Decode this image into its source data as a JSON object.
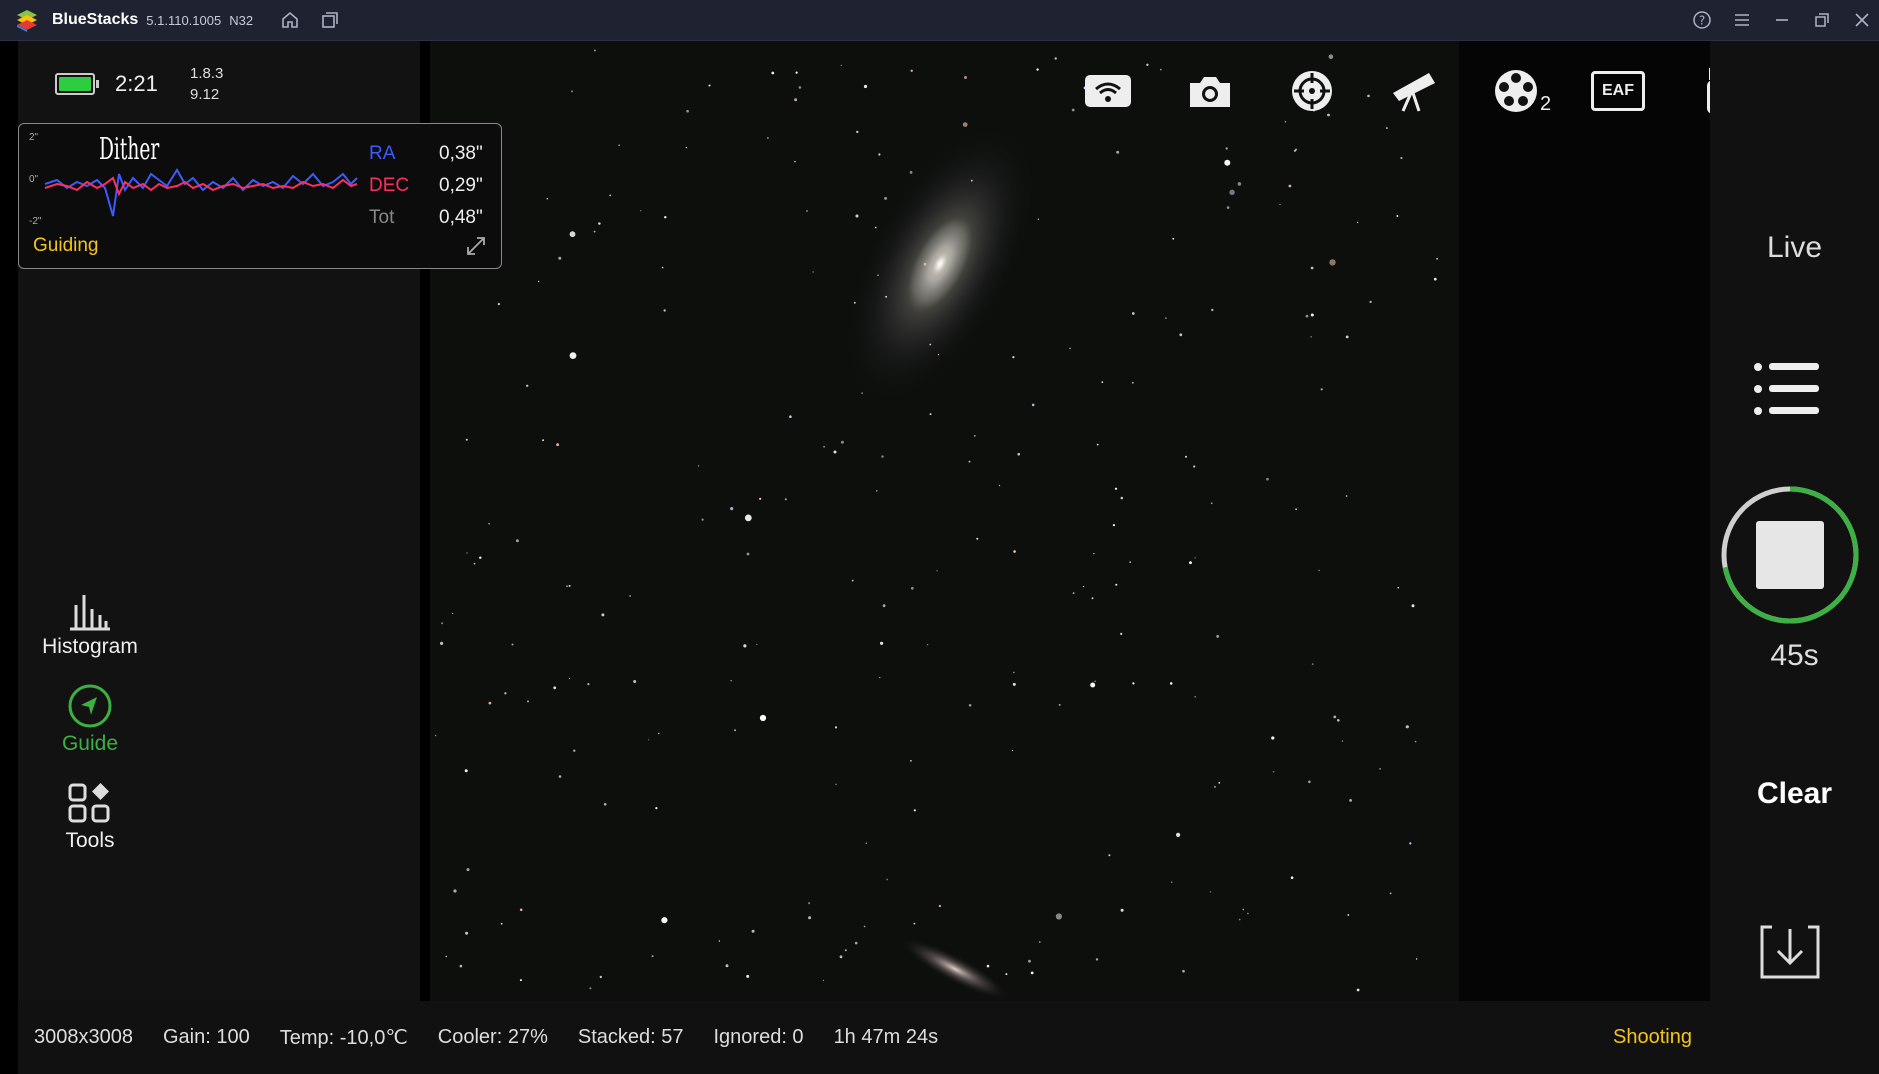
{
  "window": {
    "app_name": "BlueStacks",
    "version": "5.1.110.1005",
    "arch": "N32"
  },
  "status": {
    "time": "2:21",
    "version_line1": "1.8.3",
    "version_line2": "9.12",
    "battery_level": 1.0
  },
  "guide_graph": {
    "y_top": "2\"",
    "y_mid": "0\"",
    "y_bottom": "-2\"",
    "overlay_label": "Dither",
    "ra_label": "RA",
    "ra_value": "0,38\"",
    "dec_label": "DEC",
    "dec_value": "0,29\"",
    "tot_label": "Tot",
    "tot_value": "0,48\"",
    "status": "Guiding",
    "colors": {
      "ra": "#3b5bff",
      "dec": "#ff2e5f",
      "status": "#f5c518"
    }
  },
  "tools": [
    {
      "label": "Histogram",
      "icon": "histogram-icon",
      "active": false
    },
    {
      "label": "Guide",
      "icon": "guide-icon",
      "active": true,
      "color": "#3cb043"
    },
    {
      "label": "Tools",
      "icon": "tools-icon",
      "active": false
    }
  ],
  "top_icons": [
    {
      "name": "wifi-icon"
    },
    {
      "name": "camera-icon"
    },
    {
      "name": "crosshair-icon"
    },
    {
      "name": "telescope-icon"
    },
    {
      "name": "filter-wheel-icon",
      "badge": "2"
    },
    {
      "name": "eaf-icon",
      "text": "EAF"
    },
    {
      "name": "usb-drive-icon"
    },
    {
      "name": "info-icon"
    }
  ],
  "right_panel": {
    "live_label": "Live",
    "exposure": "45s",
    "exposure_progress": 0.72,
    "clear_label": "Clear"
  },
  "bottom_bar": {
    "resolution": "3008x3008",
    "gain": "Gain: 100",
    "temp": "Temp: -10,0℃",
    "cooler": "Cooler: 27%",
    "stacked": "Stacked: 57",
    "ignored": "Ignored: 0",
    "duration": "1h 47m 24s",
    "state": "Shooting"
  }
}
